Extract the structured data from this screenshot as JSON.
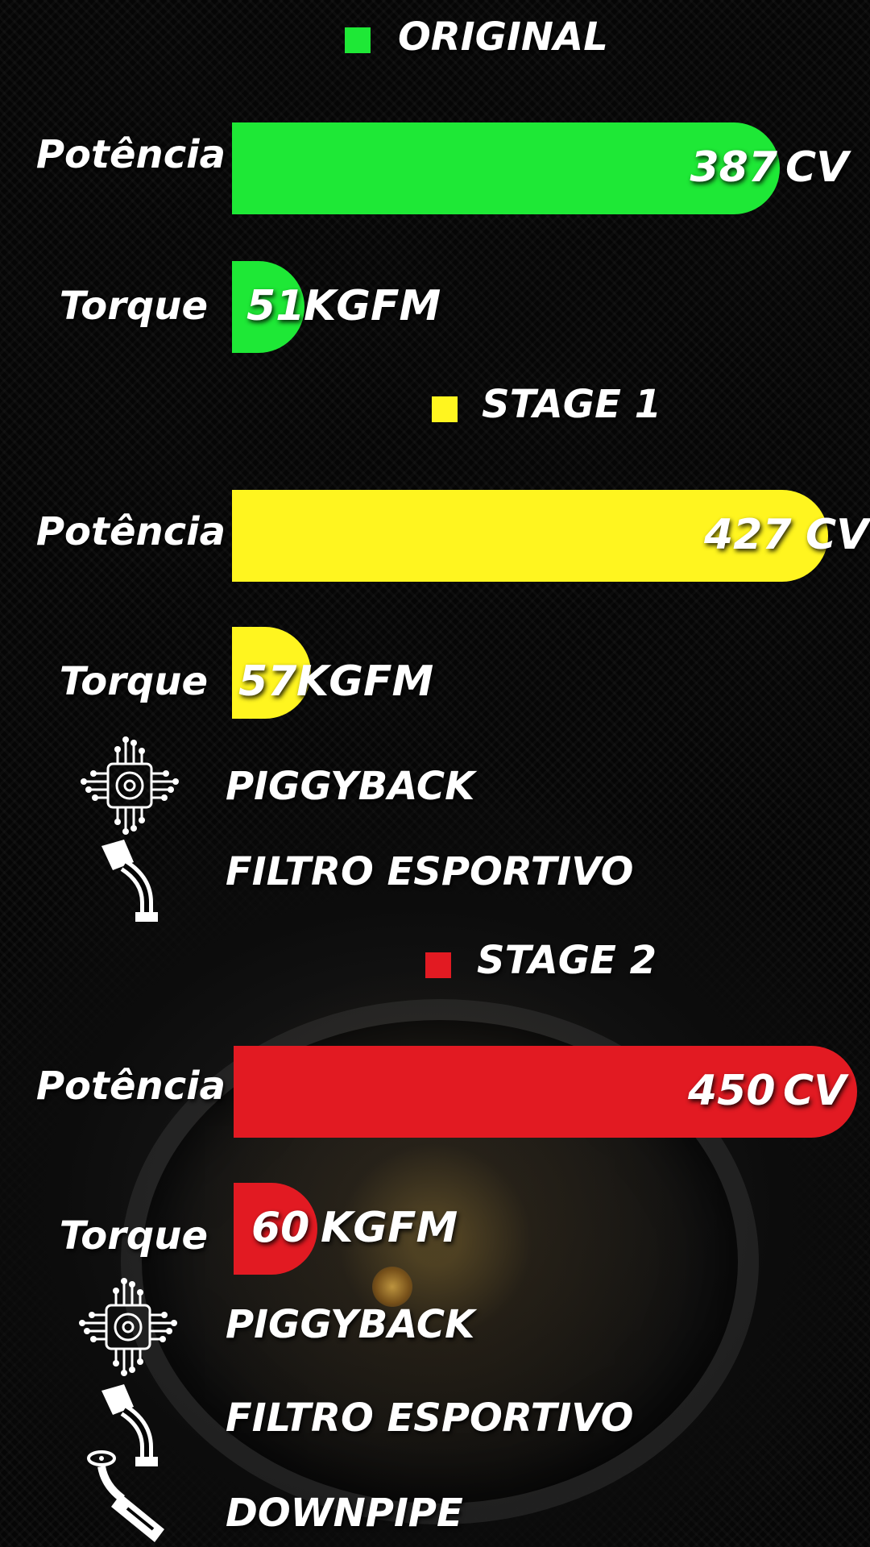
{
  "colors": {
    "original": "#1ee836",
    "stage1": "#fff51f",
    "stage2": "#e21a22"
  },
  "chart_data": {
    "type": "bar",
    "series": [
      {
        "name": "ORIGINAL",
        "categories": [
          "Potência",
          "Torque"
        ],
        "values": [
          387,
          51
        ],
        "units": [
          "CV",
          "KGFM"
        ]
      },
      {
        "name": "STAGE 1",
        "categories": [
          "Potência",
          "Torque"
        ],
        "values": [
          427,
          57
        ],
        "units": [
          "CV",
          "KGFM"
        ]
      },
      {
        "name": "STAGE 2",
        "categories": [
          "Potência",
          "Torque"
        ],
        "values": [
          450,
          60
        ],
        "units": [
          "CV",
          "KGFM"
        ]
      }
    ]
  },
  "sections": [
    {
      "name": "ORIGINAL",
      "power_label": "Potência",
      "power_value": "387",
      "power_unit": "CV",
      "torque_label": "Torque",
      "torque_value": "51",
      "torque_unit": "KGFM",
      "features": []
    },
    {
      "name": "STAGE 1",
      "power_label": "Potência",
      "power_value": "427",
      "power_unit": "CV",
      "torque_label": "Torque",
      "torque_value": "57",
      "torque_unit": "KGFM",
      "features": [
        {
          "label": "PIGGYBACK",
          "icon": "chip-turbo-icon"
        },
        {
          "label": "FILTRO ESPORTIVO",
          "icon": "intake-filter-icon"
        }
      ]
    },
    {
      "name": "STAGE 2",
      "power_label": "Potência",
      "power_value": "450",
      "power_unit": "CV",
      "torque_label": "Torque",
      "torque_value": "60",
      "torque_unit": "KGFM",
      "features": [
        {
          "label": "PIGGYBACK",
          "icon": "chip-turbo-icon"
        },
        {
          "label": "FILTRO ESPORTIVO",
          "icon": "intake-filter-icon"
        },
        {
          "label": "DOWNPIPE",
          "icon": "downpipe-icon"
        }
      ]
    }
  ]
}
